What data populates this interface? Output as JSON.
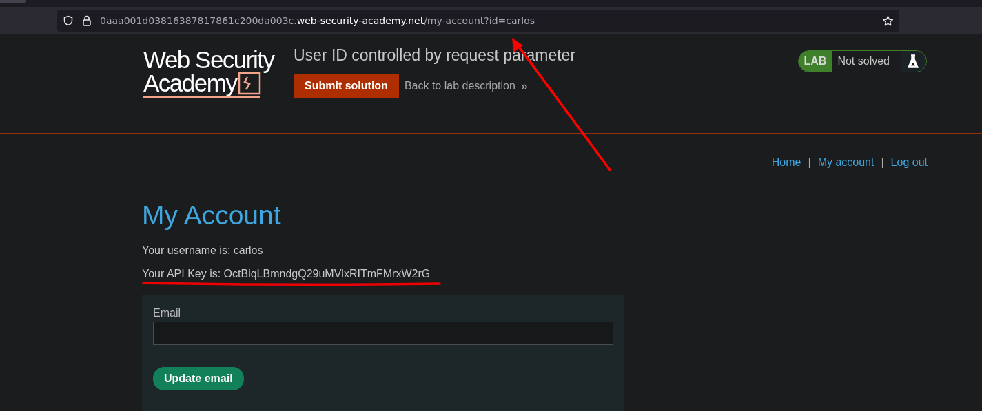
{
  "browser": {
    "url": {
      "subdomain": "0aaa001d03816387817861c200da003c.",
      "domain": "web-security-academy.net",
      "path": "/my-account?id=carlos"
    }
  },
  "header": {
    "logo": {
      "line_1": "Web Security",
      "line_2": "Academy"
    },
    "lab_title": "User ID controlled by request parameter",
    "submit_button": "Submit solution",
    "back_link": "Back to lab description",
    "back_link_icon": "»",
    "lab_status": {
      "badge": "LAB",
      "status": "Not solved",
      "solved": false
    }
  },
  "nav": [
    {
      "label": "Home"
    },
    {
      "label": "My account"
    },
    {
      "label": "Log out"
    }
  ],
  "nav_separator": "|",
  "page_title": "My Account",
  "username_line": "Your username is: carlos",
  "api_key_line": "Your API Key is: OctBiqLBmndgQ29uMVlxRITmFMrxW2rG",
  "form": {
    "email_label": "Email",
    "button": "Update email"
  }
}
